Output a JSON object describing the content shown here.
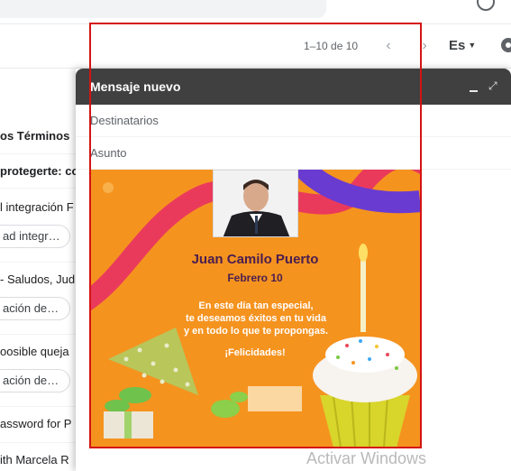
{
  "toolbar": {
    "pager_text": "1–10 de 10",
    "language_label": "Es"
  },
  "inbox_rows": [
    {
      "text": "os Términos",
      "bold": true
    },
    {
      "text": "protegerte: co",
      "bold": true
    },
    {
      "text": "l integración F",
      "bold": false
    },
    {
      "text": "ad integr…",
      "chip": true
    },
    {
      "text": "- Saludos, Jud",
      "bold": false
    },
    {
      "text": "ación de…",
      "chip": true
    },
    {
      "text": "oosible queja",
      "bold": false
    },
    {
      "text": "ación de…",
      "chip": true
    },
    {
      "text": "assword for P",
      "bold": false
    },
    {
      "text": "ith Marcela R",
      "bold": false
    }
  ],
  "compose": {
    "title": "Mensaje nuevo",
    "to_label": "Destinatarios",
    "subject_label": "Asunto"
  },
  "card": {
    "name": "Juan Camilo Puerto",
    "date": "Febrero 10",
    "message_line1": "En este día tan especial,",
    "message_line2": "te deseamos éxitos en tu vida",
    "message_line3": "y en todo lo que te propongas.",
    "cheer": "¡Felicidades!"
  },
  "watermark": "Activar Windows",
  "colors": {
    "compose_header": "#404040",
    "card_orange": "#f5931f",
    "card_name": "#4a1e4f",
    "frame_red": "#d51313"
  }
}
